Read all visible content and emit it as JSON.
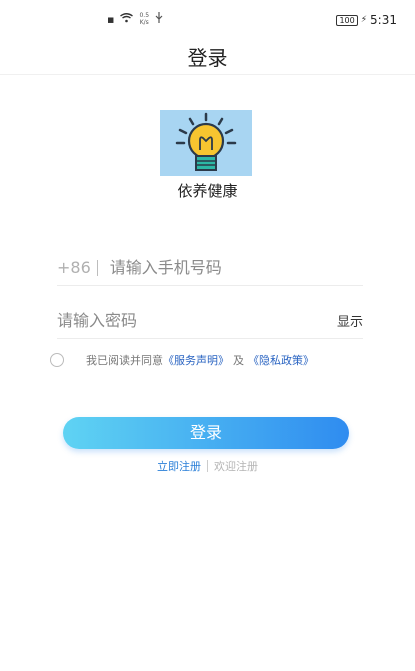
{
  "status_bar": {
    "network_speed_value": "0.5",
    "network_speed_unit": "K/s",
    "battery": "100",
    "time": "5:31"
  },
  "nav": {
    "title": "登录"
  },
  "app": {
    "name": "依养健康"
  },
  "form": {
    "phone_prefix": "+86",
    "phone_placeholder": "请输入手机号码",
    "password_placeholder": "请输入密码",
    "show_password_label": "显示"
  },
  "agreement": {
    "prefix_text": "我已阅读并同意",
    "service_link": "《服务声明》",
    "and_text": "及",
    "privacy_link": "《隐私政策》"
  },
  "actions": {
    "login_label": "登录",
    "register_label": "立即注册",
    "welcome_label": "欢迎注册"
  },
  "colors": {
    "button_gradient_start": "#5fd3f3",
    "button_gradient_end": "#2f8cf0",
    "link": "#2a64c2",
    "logo_bg": "#a8d5f2"
  }
}
